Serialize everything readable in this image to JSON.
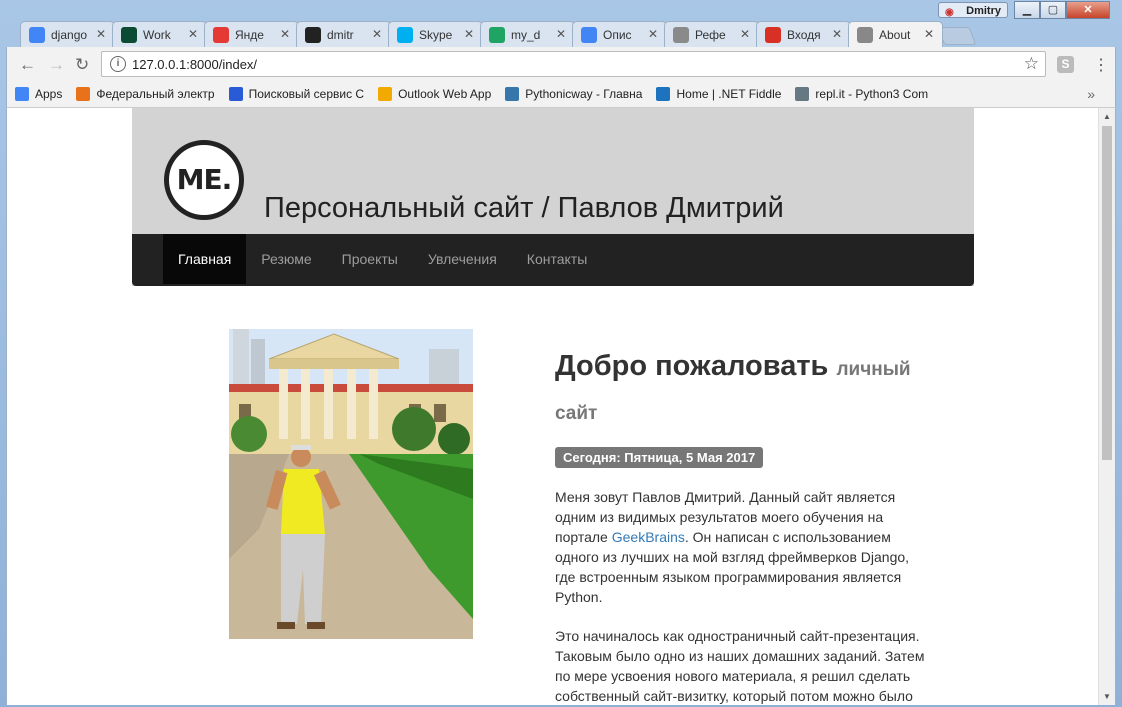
{
  "browser": {
    "user_name": "Dmitry",
    "tabs": [
      {
        "label": "django",
        "icon": "google-icon",
        "color": "#4285f4"
      },
      {
        "label": "Work",
        "icon": "django-icon",
        "color": "#0c4b33"
      },
      {
        "label": "Янде",
        "icon": "yandex-icon",
        "color": "#e53935"
      },
      {
        "label": "dmitr",
        "icon": "github-icon",
        "color": "#222222"
      },
      {
        "label": "Skype",
        "icon": "skype-icon",
        "color": "#00aff0"
      },
      {
        "label": "my_d",
        "icon": "google-drive-icon",
        "color": "#1fa463"
      },
      {
        "label": "Опис",
        "icon": "google-docs-icon",
        "color": "#4285f4"
      },
      {
        "label": "Рефе",
        "icon": "brain-icon",
        "color": "#8a8a8a"
      },
      {
        "label": "Входя",
        "icon": "gmail-icon",
        "color": "#d93025"
      },
      {
        "label": "About",
        "icon": "page-icon",
        "color": "#888888",
        "active": true
      }
    ],
    "url": "127.0.0.1:8000/index/",
    "bookmarks": [
      {
        "label": "Apps",
        "icon": "apps-icon",
        "color": "#4285f4"
      },
      {
        "label": "Федеральный электр",
        "icon": "shield-icon",
        "color": "#e8711c"
      },
      {
        "label": "Поисковый сервис С",
        "icon": "c-icon",
        "color": "#2a5bd7"
      },
      {
        "label": "Outlook Web App",
        "icon": "outlook-icon",
        "color": "#f2a900"
      },
      {
        "label": "Pythonicway - Главна",
        "icon": "python-icon",
        "color": "#3776ab"
      },
      {
        "label": "Home | .NET Fiddle",
        "icon": "fiddle-icon",
        "color": "#1e73be"
      },
      {
        "label": "repl.it - Python3 Com",
        "icon": "replit-icon",
        "color": "#667881"
      }
    ]
  },
  "site": {
    "logo_text": "ME.",
    "title": "Персональный сайт / Павлов Дмитрий",
    "nav": [
      "Главная",
      "Резюме",
      "Проекты",
      "Увлечения",
      "Контакты"
    ],
    "welcome_title": "Добро пожаловать",
    "welcome_small": "личный сайт",
    "date_label": "Сегодня: Пятница, 5 Мая 2017",
    "para1_before": "Меня зовут Павлов Дмитрий. Данный сайт является одним из видимых результатов моего обучения на портале ",
    "para1_link": "GeekBrains",
    "para1_after": ". Он написан с использованием одного из лучших на мой взгляд фреймверков Django, где встроенным языком программирования является Python.",
    "para2": "Это начиналось как одностраничный сайт-презентация. Таковым было одно из наших домашних заданий. Затем по мере усвоения нового материала, я решил сделать собственный сайт-визитку, который потом можно было бы использовать в качестве"
  }
}
